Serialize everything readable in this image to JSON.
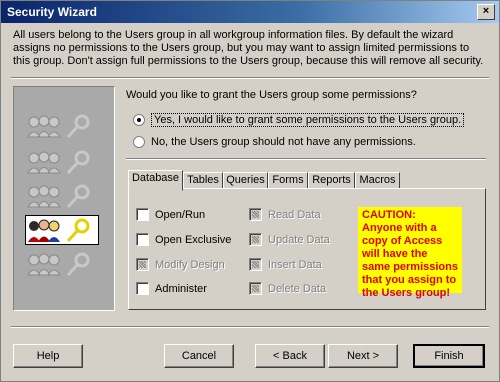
{
  "window": {
    "title": "Security Wizard",
    "close_label": "×"
  },
  "intro": {
    "text": "All users belong to the Users group in all workgroup information files. By default the wizard assigns no permissions to the Users group, but you may want to assign limited permissions to this group. Don't assign full permissions to the Users group, because this will remove all security."
  },
  "question": "Would you like to grant the Users group some permissions?",
  "options": [
    {
      "label": "Yes, I would like to grant some permissions to the Users group.",
      "checked": true
    },
    {
      "label": "No, the Users group should not have any permissions.",
      "checked": false
    }
  ],
  "tabs": [
    "Database",
    "Tables",
    "Queries",
    "Forms",
    "Reports",
    "Macros"
  ],
  "active_tab": "Database",
  "permissions_left": [
    {
      "label": "Open/Run",
      "enabled": true
    },
    {
      "label": "Open Exclusive",
      "enabled": true
    },
    {
      "label": "Modify Design",
      "enabled": false
    },
    {
      "label": "Administer",
      "enabled": true
    }
  ],
  "permissions_right": [
    {
      "label": "Read Data",
      "enabled": false
    },
    {
      "label": "Update Data",
      "enabled": false
    },
    {
      "label": "Insert Data",
      "enabled": false
    },
    {
      "label": "Delete Data",
      "enabled": false
    }
  ],
  "caution": "CAUTION: Anyone with a copy of Access will have the same permissions that you assign to the Users group!",
  "buttons": {
    "help": "Help",
    "cancel": "Cancel",
    "back": "< Back",
    "next": "Next >",
    "finish": "Finish"
  },
  "colors": {
    "titlebar": "#0a246a",
    "caution_bg": "#ffff00",
    "caution_text": "#e00000",
    "dialog_bg": "#d4d0c8"
  }
}
